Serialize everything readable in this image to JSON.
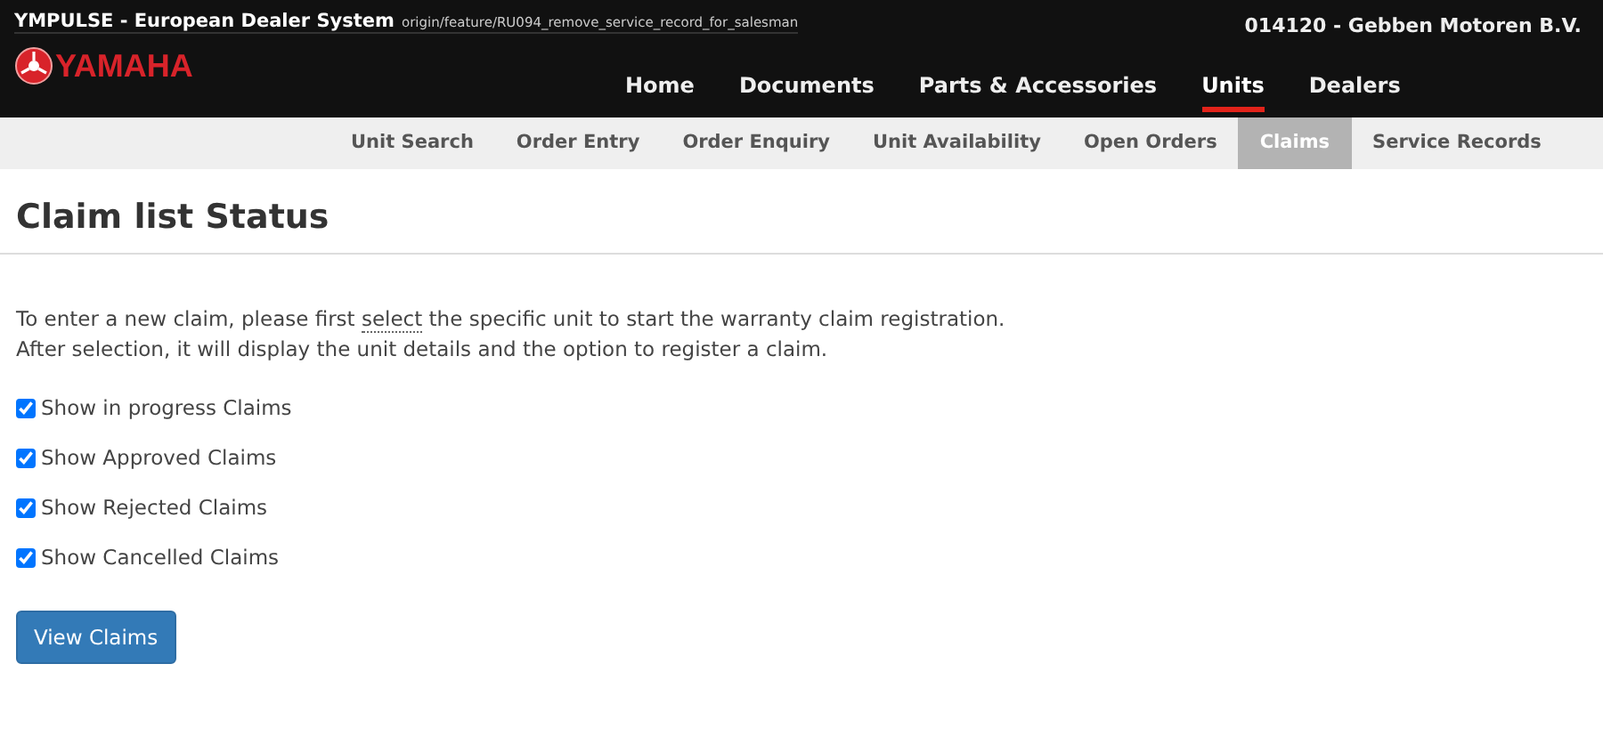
{
  "header": {
    "app_title": "YMPULSE - European Dealer System",
    "branch": "origin/feature/RU094_remove_service_record_for_salesman",
    "dealer": "014120 - Gebben Motoren B.V.",
    "logo_text": "YAMAHA"
  },
  "main_nav": [
    {
      "label": "Home",
      "selected": false
    },
    {
      "label": "Documents",
      "selected": false
    },
    {
      "label": "Parts & Accessories",
      "selected": false
    },
    {
      "label": "Units",
      "selected": true
    },
    {
      "label": "Dealers",
      "selected": false
    }
  ],
  "sub_nav": [
    {
      "label": "Unit Search",
      "selected": false
    },
    {
      "label": "Order Entry",
      "selected": false
    },
    {
      "label": "Order Enquiry",
      "selected": false
    },
    {
      "label": "Unit Availability",
      "selected": false
    },
    {
      "label": "Open Orders",
      "selected": false
    },
    {
      "label": "Claims",
      "selected": true
    },
    {
      "label": "Service Records",
      "selected": false
    }
  ],
  "page_title": "Claim list Status",
  "intro": {
    "before": "To enter a new claim, please first",
    "term": "select",
    "after": "the specific unit to start the warranty claim registration.",
    "line2": "After selection, it will display the unit details and the option to register a claim."
  },
  "filters": [
    {
      "label": "Show in progress Claims",
      "checked": true
    },
    {
      "label": "Show Approved Claims",
      "checked": true
    },
    {
      "label": "Show Rejected Claims",
      "checked": true
    },
    {
      "label": "Show Cancelled Claims",
      "checked": true
    }
  ],
  "button": "View Claims"
}
